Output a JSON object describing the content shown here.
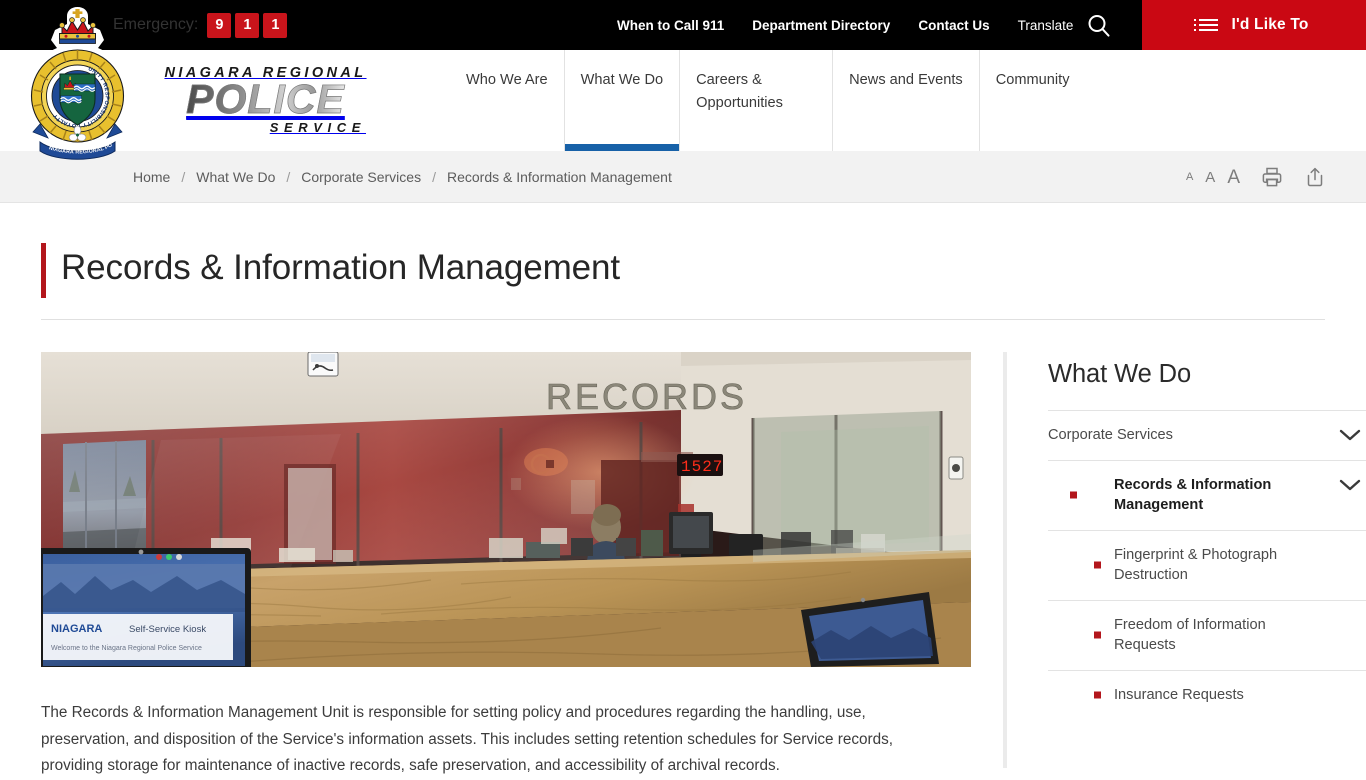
{
  "topbar": {
    "emergency_label": "Emergency:",
    "emergency_digits": [
      "9",
      "1",
      "1"
    ],
    "links": [
      {
        "label": "When to Call 911",
        "weight": "bold"
      },
      {
        "label": "Department Directory",
        "weight": "bold"
      },
      {
        "label": "Contact Us",
        "weight": "bold"
      },
      {
        "label": "Translate",
        "weight": "light"
      }
    ],
    "search_icon": "search-icon",
    "cta": {
      "label": "I'd Like To",
      "icon": "list-icon",
      "color": "#ca0813"
    }
  },
  "brand": {
    "line1": "NIAGARA REGIONAL",
    "line2": "POLICE",
    "line3": "SERVICE",
    "crest_alt": "Niagara Regional Police Service crest",
    "crest_motto": "UNITY  RESPONSIBILITY  LOYALTY",
    "crest_ribbon": "NIAGARA REGIONAL POLICE SERVICE"
  },
  "mainnav": {
    "items": [
      {
        "label": "Who We Are",
        "active": false
      },
      {
        "label": "What We Do",
        "active": true
      },
      {
        "label": "Careers & Opportunities",
        "active": false
      },
      {
        "label": "News and Events",
        "active": false
      },
      {
        "label": "Community",
        "active": false
      }
    ],
    "active_color": "#1761a8"
  },
  "breadcrumb": {
    "items": [
      "Home",
      "What We Do",
      "Corporate Services",
      "Records & Information Management"
    ],
    "separator": "/",
    "tools": {
      "text_small": "A",
      "text_medium": "A",
      "text_large": "A",
      "print_icon": "printer-icon",
      "share_icon": "share-icon"
    }
  },
  "page": {
    "title": "Records & Information Management",
    "accent_color": "#b3161c"
  },
  "photo": {
    "caption": "RECORDS",
    "clock": "1527",
    "kiosk_brand": "NIAGARA",
    "kiosk_label": "Self-Service Kiosk",
    "kiosk_sub": "Welcome to the Niagara Regional Police Service"
  },
  "body": {
    "paragraph": "The Records & Information Management Unit is responsible for setting policy and procedures regarding the handling, use, preservation, and disposition of the Service's information assets.  This includes setting retention schedules for Service records, providing storage for maintenance of inactive records, safe preservation, and accessibility of archival records."
  },
  "sidebar": {
    "title": "What We Do",
    "items": [
      {
        "label": "Corporate Services",
        "level": 1,
        "current": false,
        "chevron": true,
        "bullet": false
      },
      {
        "label": "Records & Information Management",
        "level": 2,
        "current": true,
        "chevron": true,
        "bullet": true
      },
      {
        "label": "Fingerprint & Photograph Destruction",
        "level": 3,
        "current": false,
        "chevron": false,
        "bullet": true
      },
      {
        "label": "Freedom of Information Requests",
        "level": 3,
        "current": false,
        "chevron": false,
        "bullet": true
      },
      {
        "label": "Insurance Requests",
        "level": 3,
        "current": false,
        "chevron": false,
        "bullet": true
      }
    ],
    "bullet_color": "#b3161c"
  }
}
